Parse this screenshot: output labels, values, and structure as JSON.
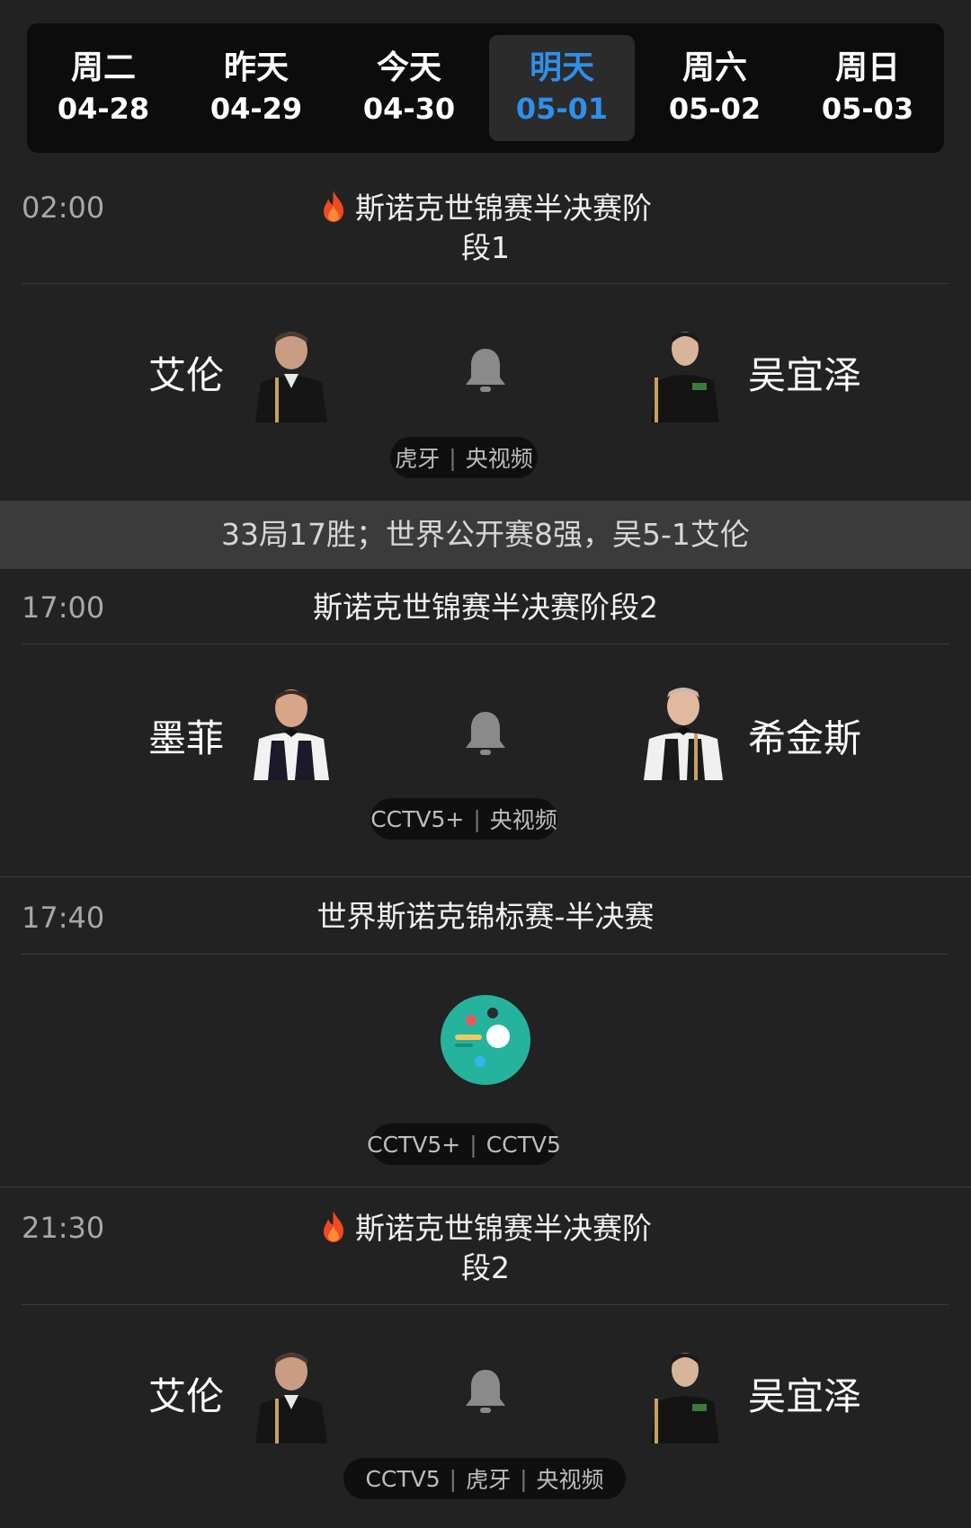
{
  "dates": [
    {
      "weekday": "周二",
      "date": "04-28"
    },
    {
      "weekday": "昨天",
      "date": "04-29"
    },
    {
      "weekday": "今天",
      "date": "04-30"
    },
    {
      "weekday": "明天",
      "date": "05-01"
    },
    {
      "weekday": "周六",
      "date": "05-02"
    },
    {
      "weekday": "周日",
      "date": "05-03"
    }
  ],
  "active_date_index": 3,
  "accent_color": "#2f8fea",
  "matches": [
    {
      "time": "02:00",
      "title_line1": "斯诺克世锦赛半决赛阶",
      "title_line2": "段1",
      "hot": true,
      "home": "艾伦",
      "away": "吴宜泽",
      "channels": [
        "虎牙",
        "央视频"
      ]
    },
    {
      "time": "17:00",
      "title": "斯诺克世锦赛半决赛阶段2",
      "home": "墨菲",
      "away": "希金斯",
      "channels": [
        "CCTV5+",
        "央视频"
      ]
    },
    {
      "time": "17:40",
      "title": "世界斯诺克锦标赛-半决赛",
      "channels": [
        "CCTV5+",
        "CCTV5"
      ]
    },
    {
      "time": "21:30",
      "title_line1": "斯诺克世锦赛半决赛阶",
      "title_line2": "段2",
      "hot": true,
      "home": "艾伦",
      "away": "吴宜泽",
      "channels": [
        "CCTV5",
        "虎牙",
        "央视频"
      ]
    }
  ],
  "note": "33局17胜；世界公开赛8强，吴5-1艾伦",
  "icons": {
    "hot": "fire-icon",
    "reminder": "bell-icon",
    "app": "snooker-app-icon"
  }
}
